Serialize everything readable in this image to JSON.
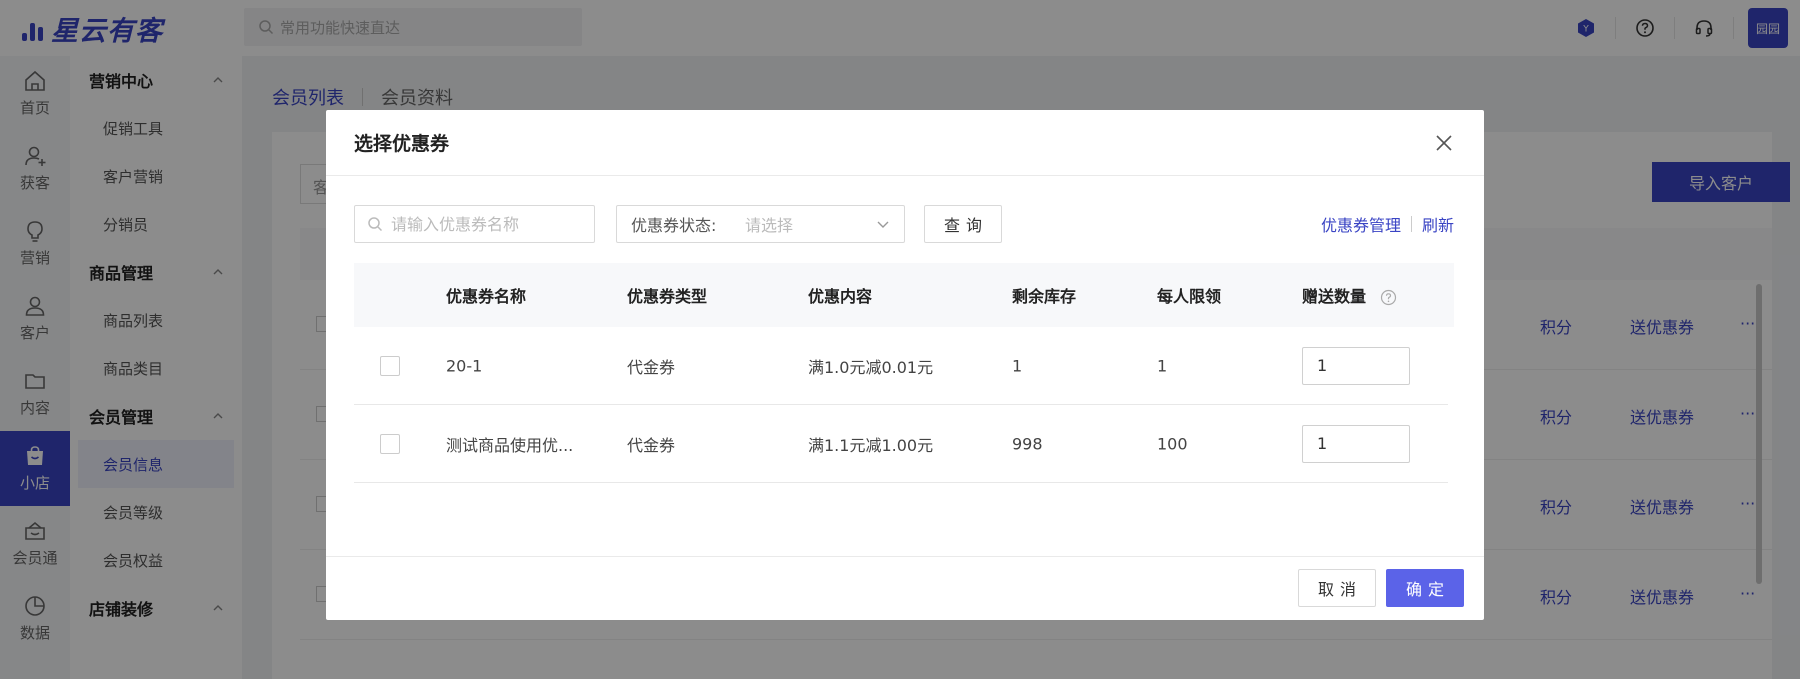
{
  "app": {
    "logo_text": "星云有客",
    "search_placeholder": "常用功能快速直达",
    "avatar_label": "园园",
    "top_icons": [
      "brand-badge-icon",
      "help-circle-icon",
      "headset-icon"
    ]
  },
  "rail": {
    "items": [
      {
        "label": "首页",
        "icon": "home-icon"
      },
      {
        "label": "获客",
        "icon": "user-add-icon"
      },
      {
        "label": "营销",
        "icon": "bulb-icon"
      },
      {
        "label": "客户",
        "icon": "user-icon"
      },
      {
        "label": "内容",
        "icon": "folder-icon"
      },
      {
        "label": "小店",
        "icon": "shop-bag-icon",
        "active": true
      },
      {
        "label": "会员通",
        "icon": "member-icon"
      },
      {
        "label": "数据",
        "icon": "pie-chart-icon"
      }
    ]
  },
  "submenu": {
    "groups": [
      {
        "title": "营销中心",
        "items": [
          "促销工具",
          "客户营销",
          "分销员"
        ]
      },
      {
        "title": "商品管理",
        "items": [
          "商品列表",
          "商品类目"
        ]
      },
      {
        "title": "会员管理",
        "items": [
          "会员信息",
          "会员等级",
          "会员权益"
        ]
      },
      {
        "title": "店铺装修",
        "items": []
      }
    ],
    "active_item": "会员信息"
  },
  "main": {
    "tabs": [
      {
        "label": "会员列表",
        "active": true
      },
      {
        "label": "会员资料",
        "active": false
      }
    ],
    "filter_hint": "客",
    "import_button": "导入客户",
    "row_actions": [
      "积分",
      "送优惠券",
      "···"
    ]
  },
  "modal": {
    "title": "选择优惠券",
    "name_placeholder": "请输入优惠券名称",
    "status_label": "优惠券状态:",
    "status_placeholder": "请选择",
    "query_button": "查询",
    "manage_link": "优惠券管理",
    "refresh_link": "刷新",
    "columns": {
      "name": "优惠券名称",
      "type": "优惠券类型",
      "content": "优惠内容",
      "stock": "剩余库存",
      "limit": "每人限领",
      "qty": "赠送数量"
    },
    "rows": [
      {
        "name": "20-1",
        "type": "代金券",
        "content": "满1.0元减0.01元",
        "stock": "1",
        "limit": "1",
        "qty": "1",
        "checked": false
      },
      {
        "name": "测试商品使用优...",
        "type": "代金券",
        "content": "满1.1元减1.00元",
        "stock": "998",
        "limit": "100",
        "qty": "1",
        "checked": false
      }
    ],
    "cancel_button": "取消",
    "ok_button": "确定"
  },
  "colors": {
    "brand": "#3a44c4",
    "primary_button": "#5b63e8",
    "overlay": "rgba(0,0,0,0.45)"
  }
}
